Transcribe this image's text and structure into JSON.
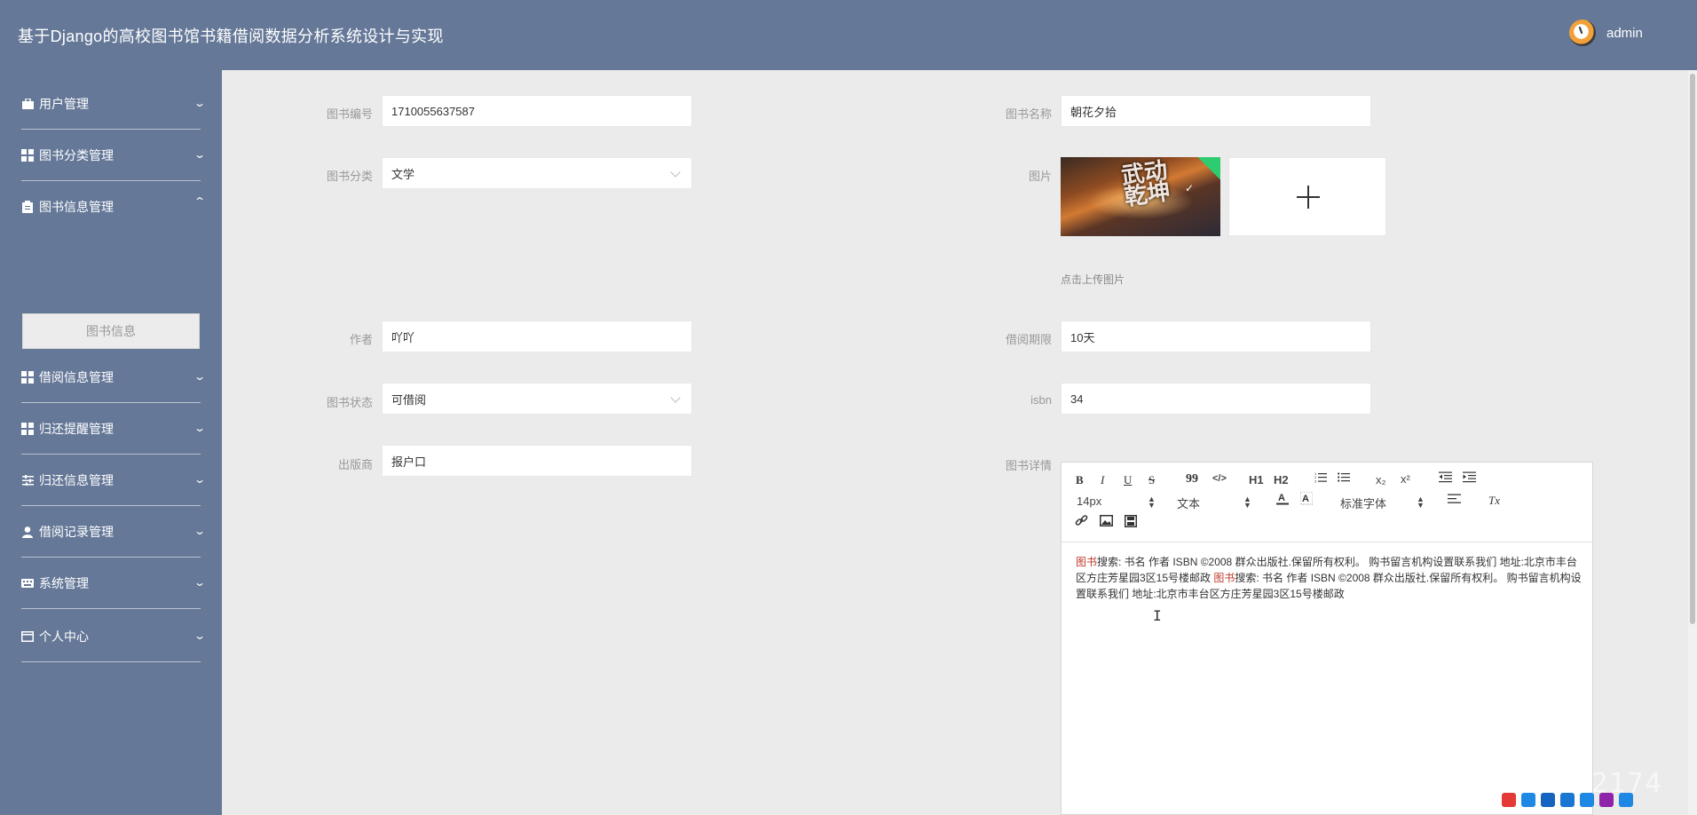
{
  "header": {
    "app_title": "基于Django的高校图书馆书籍借阅数据分析系统设计与实现",
    "user_name": "admin",
    "avatar_icon": "avatar-icon"
  },
  "sidebar": {
    "items": [
      {
        "label": "用户管理",
        "icon": "briefcase-icon",
        "expanded": false
      },
      {
        "label": "图书分类管理",
        "icon": "grid-icon",
        "expanded": false
      },
      {
        "label": "图书信息管理",
        "icon": "clipboard-icon",
        "expanded": true
      },
      {
        "label": "借阅信息管理",
        "icon": "grid-icon",
        "expanded": false
      },
      {
        "label": "归还提醒管理",
        "icon": "grid-icon",
        "expanded": false
      },
      {
        "label": "归还信息管理",
        "icon": "sliders-icon",
        "expanded": false
      },
      {
        "label": "借阅记录管理",
        "icon": "user-icon",
        "expanded": false
      },
      {
        "label": "系统管理",
        "icon": "keyboard-icon",
        "expanded": false
      },
      {
        "label": "个人中心",
        "icon": "card-icon",
        "expanded": false
      }
    ],
    "submenu_label": "图书信息"
  },
  "form": {
    "book_no": {
      "label": "图书编号",
      "value": "1710055637587"
    },
    "book_name": {
      "label": "图书名称",
      "value": "朝花夕拾"
    },
    "category": {
      "label": "图书分类",
      "value": "文学"
    },
    "image": {
      "label": "图片",
      "upload_hint": "点击上传图片",
      "cover_text": "武动乾坤"
    },
    "author": {
      "label": "作者",
      "value": "吖吖"
    },
    "borrow_period": {
      "label": "借阅期限",
      "value": "10天"
    },
    "status": {
      "label": "图书状态",
      "value": "可借阅"
    },
    "isbn": {
      "label": "isbn",
      "value": "34"
    },
    "publisher": {
      "label": "出版商",
      "value": "报户口"
    },
    "details": {
      "label": "图书详情"
    }
  },
  "editor": {
    "toolbar": {
      "bold": "B",
      "italic": "I",
      "underline": "U",
      "strike": "S",
      "quote": "99",
      "code": "</>",
      "h1": "H1",
      "h2": "H2",
      "sub": "x₂",
      "sup": "x²",
      "size": "14px",
      "format": "文本",
      "font": "标准字体",
      "clear": "Tx"
    },
    "content": {
      "part1_hl": "图书",
      "part1": "搜索: 书名 作者 ISBN ©2008 群众出版社.保留所有权利。 购书留言机构设置联系我们 地址:北京市丰台区方庄芳星园3区15号楼邮政 ",
      "part2_hl": "图书",
      "part2": "搜索: 书名 作者 ISBN ©2008 群众出版社.保留所有权利。 购书留言机构设置联系我们 地址:北京市丰台区方庄芳星园3区15号楼邮政"
    }
  },
  "watermark": "CSDN @QQ3359892174"
}
